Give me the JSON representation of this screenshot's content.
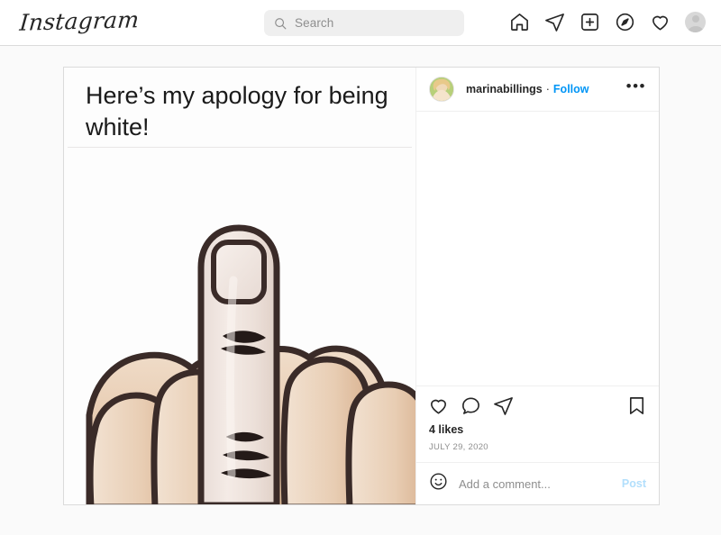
{
  "header": {
    "logo": "Instagram",
    "search": {
      "placeholder": "Search",
      "value": "",
      "icon": "search-icon"
    },
    "nav": [
      {
        "name": "home-icon",
        "label": "Home"
      },
      {
        "name": "direct-message-icon",
        "label": "Messages"
      },
      {
        "name": "new-post-icon",
        "label": "New post"
      },
      {
        "name": "explore-icon",
        "label": "Explore"
      },
      {
        "name": "activity-heart-icon",
        "label": "Activity"
      },
      {
        "name": "profile-avatar",
        "label": "Profile"
      }
    ]
  },
  "post": {
    "username": "marinabillings",
    "separator": "·",
    "follow_label": "Follow",
    "menu_label": "•••",
    "media": {
      "caption_text": "Here’s my apology for being white!",
      "description": "Cartoon illustration of a hand raising its middle finger"
    },
    "actions": {
      "like": "like-heart-icon",
      "comment": "comment-bubble-icon",
      "share": "share-paper-plane-icon",
      "save": "bookmark-icon"
    },
    "likes": "4 likes",
    "date": "JULY 29, 2020",
    "comment_box": {
      "emoji_icon": "emoji-smiley-icon",
      "placeholder": "Add a comment...",
      "value": "",
      "post_label": "Post"
    }
  },
  "colors": {
    "accent_blue": "#0095f6",
    "post_disabled_blue": "#b2dffc",
    "page_background": "#fafafa",
    "border": "#dbdbdb",
    "text_primary": "#262626",
    "text_secondary": "#8e8e8e"
  }
}
